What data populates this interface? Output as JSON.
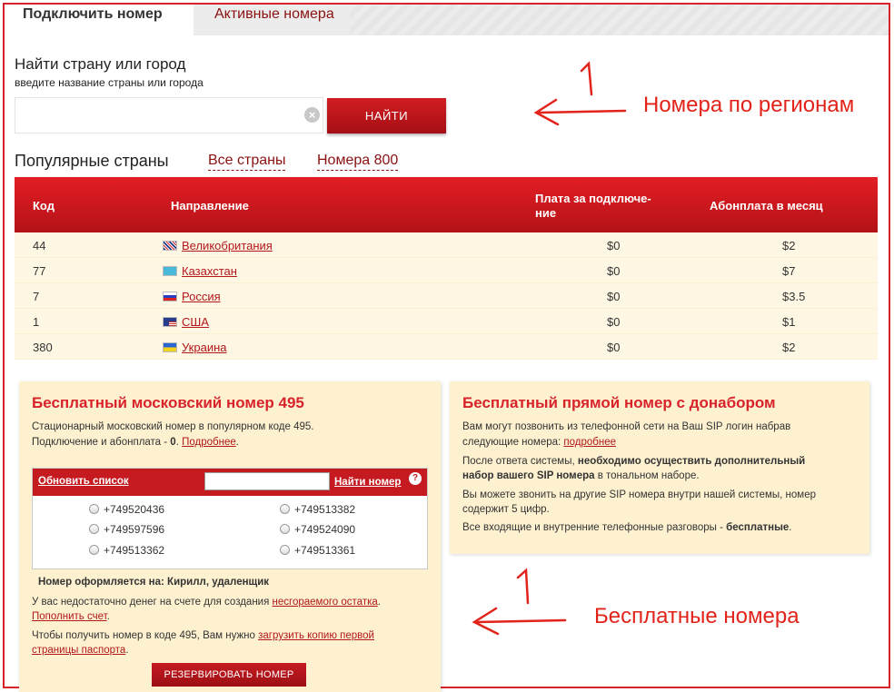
{
  "tabs": {
    "active": "Подключить номер",
    "inactive": "Активные номера"
  },
  "search": {
    "title": "Найти страну или город",
    "subtitle": "введите название страны или города",
    "placeholder": "",
    "button": "НАЙТИ"
  },
  "annotations": {
    "top_number": "1",
    "top_label": "Номера по регионам",
    "bottom_number": "1",
    "bottom_label": "Бесплатные номера",
    "color": "#e2231a"
  },
  "popular": {
    "title": "Популярные страны",
    "links": [
      "Все страны",
      "Номера 800"
    ]
  },
  "table": {
    "headers": [
      "Код",
      "Направление",
      "Плата за подключе-",
      "ние",
      "Абонплата в месяц"
    ],
    "rows": [
      {
        "code": "44",
        "direction": "Великобритания",
        "fee": "$0",
        "monthly": "$2",
        "flag": "gb-flag-icon"
      },
      {
        "code": "77",
        "direction": "Казахстан",
        "fee": "$0",
        "monthly": "$7",
        "flag": "kz-flag-icon"
      },
      {
        "code": "7",
        "direction": "Россия",
        "fee": "$0",
        "monthly": "$3.5",
        "flag": "ru-flag-icon"
      },
      {
        "code": "1",
        "direction": "США",
        "fee": "$0",
        "monthly": "$1",
        "flag": "us-flag-icon"
      },
      {
        "code": "380",
        "direction": "Украина",
        "fee": "$0",
        "monthly": "$2",
        "flag": "ua-flag-icon"
      }
    ]
  },
  "moscow": {
    "title": "Бесплатный московский номер 495",
    "line1": "Стационарный московский номер в популярном коде 495.",
    "line2_a": "Подключение и абонплата - ",
    "line2_b": "0",
    "line2_c": ". ",
    "line2_link": "Подробнее",
    "line2_d": ".",
    "refresh": "Обновить список",
    "find_number": "Найти номер",
    "help": "?",
    "numbers_left": [
      "+749520436",
      "+749597596",
      "+749513362"
    ],
    "numbers_right": [
      "+749513382",
      "+749524090",
      "+749513361"
    ],
    "owner": "Номер оформляется на: Кирилл, удаленщик",
    "balance_a": "У вас недостаточно денег на счете для создания ",
    "balance_link": "несгораемого остатка",
    "balance_b": ".",
    "topup": "Пополнить счет",
    "topup_end": ".",
    "passport_a": "Чтобы получить номер в коде 495, Вам нужно ",
    "passport_link1": "загрузить копию первой",
    "passport_link2": "страницы паспорта",
    "passport_end": ".",
    "reserve": "РЕЗЕРВИРОВАТЬ НОМЕР"
  },
  "direct": {
    "title": "Бесплатный прямой номер с донабором",
    "p1a": "Вам могут позвонить из телефонной сети на Ваш SIP логин набрав",
    "p1b": "следующие номера: ",
    "p1link": "подробнее",
    "p2a": "После ответа системы, ",
    "p2b": "необходимо осуществить дополнительный",
    "p2c": "набор вашего SIP номера",
    "p2d": " в тональном наборе.",
    "p3a": "Вы можете звонить на другие SIP номера внутри нашей системы, номер",
    "p3b": "содержит 5 цифр.",
    "p4a": "Все входящие и внутренние телефонные разговоры - ",
    "p4b": "бесплатные",
    "p4c": "."
  }
}
